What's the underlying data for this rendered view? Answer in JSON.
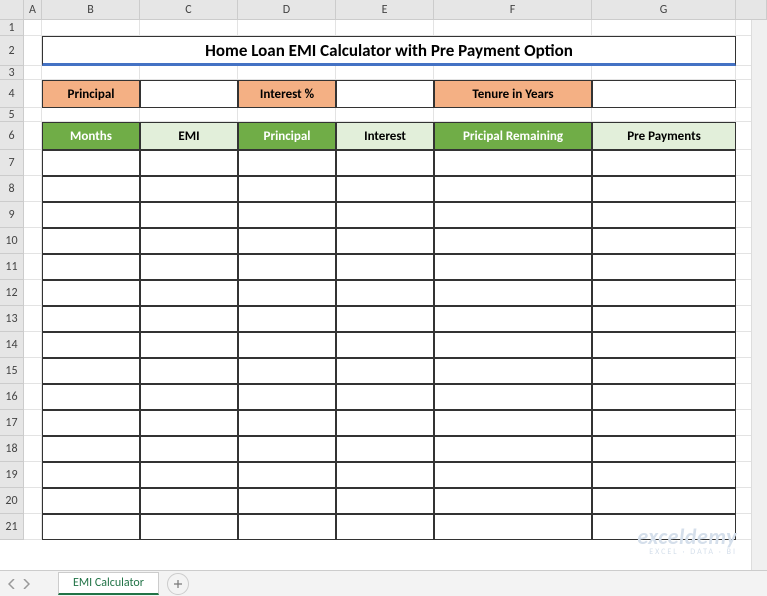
{
  "columns": [
    "A",
    "B",
    "C",
    "D",
    "E",
    "F",
    "G"
  ],
  "title": "Home Loan EMI Calculator with Pre Payment Option",
  "inputs": {
    "principal_label": "Principal",
    "principal_value": "",
    "interest_label": "Interest %",
    "interest_value": "",
    "tenure_label": "Tenure in Years",
    "tenure_value": ""
  },
  "table_headers": {
    "months": "Months",
    "emi": "EMI",
    "principal": "Principal",
    "interest": "Interest",
    "remaining": "Pricipal Remaining",
    "prepayments": "Pre Payments"
  },
  "data_row_numbers": [
    7,
    8,
    9,
    10,
    11,
    12,
    13,
    14,
    15,
    16,
    17,
    18,
    19,
    20,
    21
  ],
  "sheet_tab": "EMI Calculator",
  "watermark": {
    "main": "exceldemy",
    "sub": "EXCEL · DATA · BI"
  }
}
